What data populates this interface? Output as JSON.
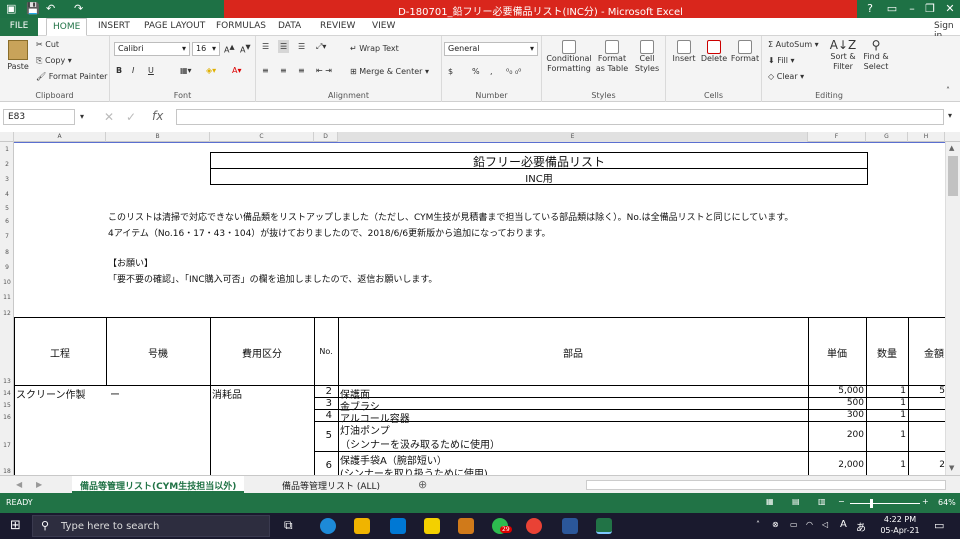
{
  "window": {
    "title": "D-180701_鉛フリー必要備品リスト(INC分) - Microsoft Excel",
    "help": "?",
    "signin": "Sign in"
  },
  "tabs": [
    "FILE",
    "HOME",
    "INSERT",
    "PAGE LAYOUT",
    "FORMULAS",
    "DATA",
    "REVIEW",
    "VIEW"
  ],
  "clipboard": {
    "paste": "Paste",
    "cut": "Cut",
    "copy": "Copy",
    "format_painter": "Format Painter",
    "label": "Clipboard"
  },
  "font": {
    "name": "Calibri",
    "size": "16",
    "label": "Font",
    "bold": "B",
    "italic": "I",
    "underline": "U"
  },
  "alignment": {
    "wrap": "Wrap Text",
    "merge": "Merge & Center",
    "label": "Alignment"
  },
  "number": {
    "format": "General",
    "currency": "$",
    "percent": "%",
    "comma": ",",
    "label": "Number"
  },
  "styles": {
    "conditional": "Conditional Formatting",
    "format_table": "Format as Table",
    "cell_styles": "Cell Styles",
    "label": "Styles"
  },
  "cells": {
    "insert": "Insert",
    "delete": "Delete",
    "format": "Format",
    "label": "Cells"
  },
  "editing": {
    "autosum": "AutoSum",
    "fill": "Fill",
    "clear": "Clear",
    "sort": "Sort & Filter",
    "find": "Find & Select",
    "label": "Editing"
  },
  "formula_bar": {
    "name_box": "E83",
    "fx": "fx",
    "value": ""
  },
  "columns": [
    "A",
    "B",
    "C",
    "D",
    "E",
    "F",
    "G",
    "H"
  ],
  "rows": [
    "1",
    "2",
    "3",
    "4",
    "5",
    "6",
    "7",
    "8",
    "9",
    "10",
    "11",
    "12",
    "13",
    "14",
    "15",
    "16",
    "17",
    "18"
  ],
  "sheet": {
    "title1": "鉛フリー必要備品リスト",
    "title2": "INC用",
    "note1": "このリストは清掃で対応できない備品類をリストアップしました（ただし、CYM生技が見積書まで担当している部品類は除く）。No.は全備品リストと同じにしています。",
    "note2": "4アイテム（No.16・17・43・104）が抜けておりましたので、2018/6/6更新版から追加になっております。",
    "req_head": "【お願い】",
    "req_body": "「要不要の確認」、「INC購入可否」の欄を追加しましたので、返信お願いします。",
    "headers": {
      "process": "工程",
      "machine": "号機",
      "cost": "費用区分",
      "no": "No.",
      "part": "部品",
      "price": "単価",
      "qty": "数量",
      "amount": "金額"
    },
    "first": {
      "process": "スクリーン作製",
      "machine": "ー",
      "cost": "消耗品"
    },
    "items": [
      {
        "no": "2",
        "part": "保護面",
        "price": "5,000",
        "qty": "1",
        "amount": "5"
      },
      {
        "no": "3",
        "part": "金ブラシ",
        "price": "500",
        "qty": "1",
        "amount": ""
      },
      {
        "no": "4",
        "part": "アルコール容器",
        "price": "300",
        "qty": "1",
        "amount": ""
      },
      {
        "no": "5",
        "part": "灯油ポンプ",
        "part2": "（シンナーを汲み取るために使用）",
        "price": "200",
        "qty": "1",
        "amount": ""
      },
      {
        "no": "6",
        "part": "保護手袋A（腕部短い）",
        "part2": "(シンナーを取り扱うために使用)",
        "price": "2,000",
        "qty": "1",
        "amount": "2"
      }
    ]
  },
  "sheet_tabs": [
    "備品等管理リスト(CYM生技担当以外)",
    "備品等管理リスト (ALL)"
  ],
  "status": {
    "ready": "READY",
    "zoom": "64%"
  },
  "taskbar": {
    "search": "Type here to search",
    "time": "4:22 PM",
    "date": "05-Apr-21",
    "badge": "29"
  }
}
